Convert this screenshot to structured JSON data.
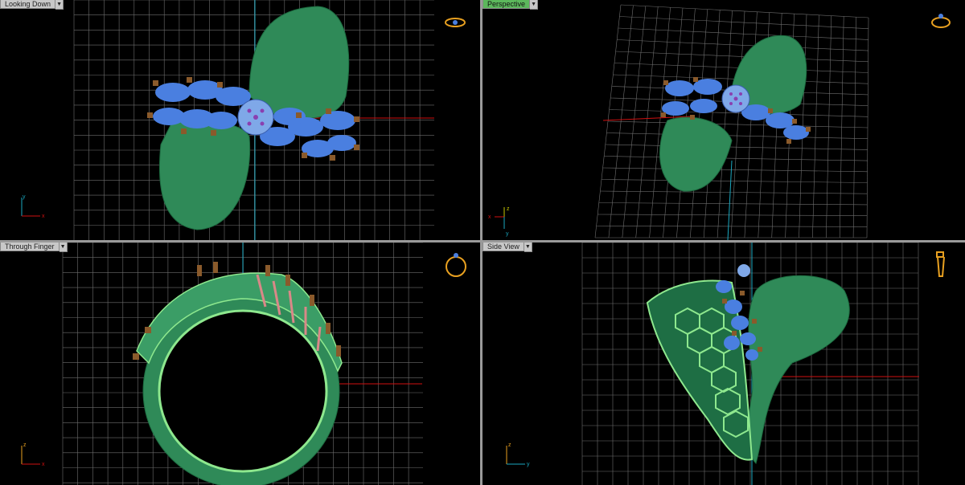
{
  "viewports": {
    "top_left": {
      "label": "Looking Down"
    },
    "top_right": {
      "label": "Perspective"
    },
    "bottom_left": {
      "label": "Through Finger"
    },
    "bottom_right": {
      "label": "Side View"
    }
  },
  "axes": {
    "top_left": {
      "v": "y",
      "h": "x"
    },
    "top_right": {
      "v": "z",
      "h": "x",
      "d": "y"
    },
    "bottom_left": {
      "v": "z",
      "h": "x"
    },
    "bottom_right": {
      "v": "z",
      "h": "y"
    }
  },
  "colors": {
    "grid": "#6e6e6e",
    "ring_body": "#2f8a58",
    "ring_highlight": "#8ee88e",
    "gem_blue": "#4a7fe0",
    "gem_center": "#7fa8e8",
    "accent_purple": "#8a3fb0",
    "prong_brown": "#8a5a2b",
    "prong_pink": "#d98888",
    "axis_red": "#d01010",
    "axis_cyan": "#1aa8c0",
    "icon_gold": "#e8a020",
    "tab_active": "#5cb85c",
    "tab_inactive": "#c8c8c8"
  }
}
